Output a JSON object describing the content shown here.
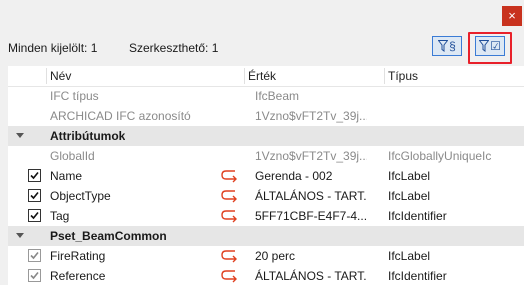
{
  "window": {
    "close_label": "×"
  },
  "info": {
    "selected": "Minden kijelölt: 1",
    "editable": "Szerkeszthető: 1"
  },
  "filters": {
    "filter1_label": "§",
    "filter2_label": "☑"
  },
  "table": {
    "headers": {
      "name": "Név",
      "value": "Érték",
      "type": "Típus"
    },
    "rows": [
      {
        "kind": "plain",
        "name": "IFC típus",
        "value": "IfcBeam",
        "type": ""
      },
      {
        "kind": "plain",
        "name": "ARCHICAD IFC azonosító",
        "value": "1Vzno$vFT2Tv_39j...",
        "type": ""
      },
      {
        "kind": "group",
        "name": "Attribútumok"
      },
      {
        "kind": "plain",
        "name": "GlobalId",
        "value": "1Vzno$vFT2Tv_39j...",
        "type": "IfcGloballyUniqueIc"
      },
      {
        "kind": "check",
        "name": "Name",
        "value": "Gerenda - 002",
        "type": "IfcLabel"
      },
      {
        "kind": "check",
        "name": "ObjectType",
        "value": "ÁLTALÁNOS - TART...",
        "type": "IfcLabel"
      },
      {
        "kind": "check",
        "name": "Tag",
        "value": "5FF71CBF-E4F7-4...",
        "type": "IfcIdentifier"
      },
      {
        "kind": "group",
        "name": "Pset_BeamCommon"
      },
      {
        "kind": "check-dim",
        "name": "FireRating",
        "value": "20 perc",
        "type": "IfcLabel"
      },
      {
        "kind": "check-dim",
        "name": "Reference",
        "value": "ÁLTALÁNOS - TART...",
        "type": "IfcIdentifier"
      }
    ]
  }
}
